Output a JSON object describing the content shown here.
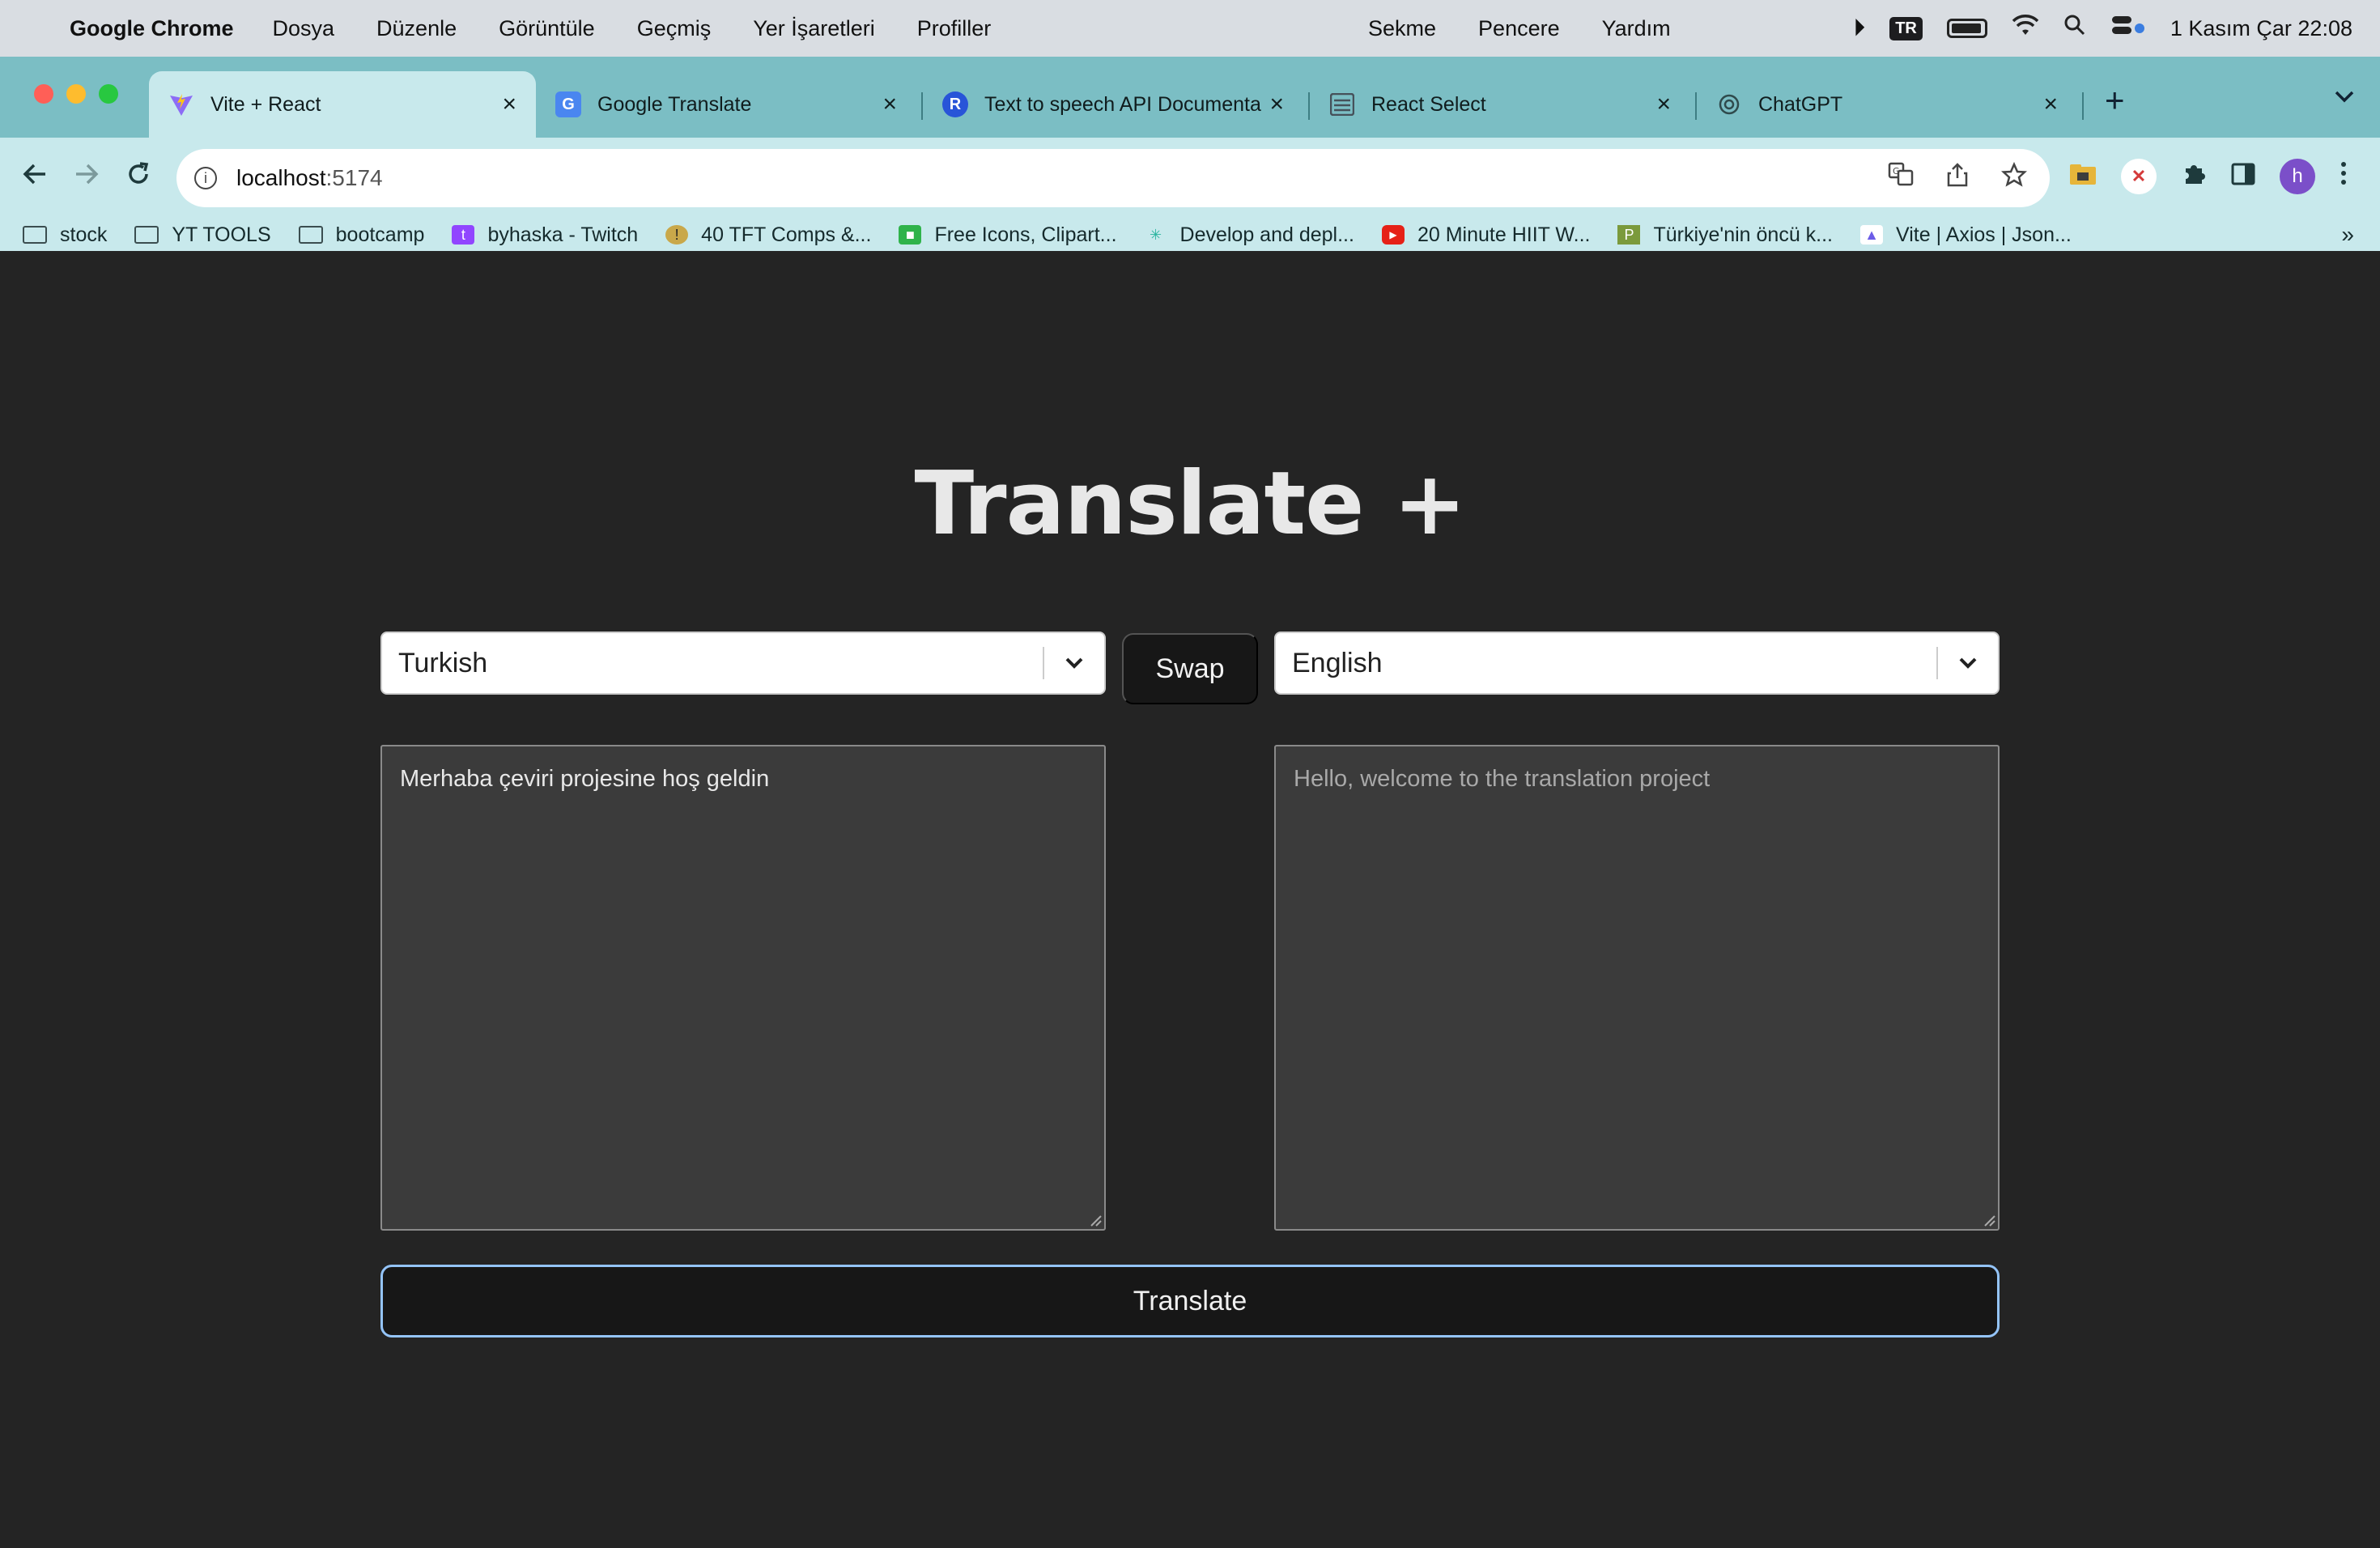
{
  "menubar": {
    "app_name": "Google Chrome",
    "items": [
      "Dosya",
      "Düzenle",
      "Görüntüle",
      "Geçmiş",
      "Yer İşaretleri",
      "Profiller"
    ],
    "right_items": [
      "Sekme",
      "Pencere",
      "Yardım"
    ],
    "input_source": "TR",
    "clock": "1 Kasım Çar  22:08"
  },
  "tabs": [
    {
      "title": "Vite + React",
      "active": true
    },
    {
      "title": "Google Translate",
      "active": false
    },
    {
      "title": "Text to speech API Documentati",
      "active": false
    },
    {
      "title": "React Select",
      "active": false
    },
    {
      "title": "ChatGPT",
      "active": false
    }
  ],
  "omnibox": {
    "host": "localhost",
    "port": ":5174"
  },
  "profile_initial": "h",
  "bookmarks": [
    {
      "label": "stock",
      "icon": "folder-icon"
    },
    {
      "label": "YT TOOLS",
      "icon": "folder-icon"
    },
    {
      "label": "bootcamp",
      "icon": "folder-icon"
    },
    {
      "label": "byhaska - Twitch",
      "icon": "twitch-icon"
    },
    {
      "label": "40 TFT Comps &...",
      "icon": "tft-icon"
    },
    {
      "label": "Free Icons, Clipart...",
      "icon": "icons-site-icon"
    },
    {
      "label": "Develop and depl...",
      "icon": "deploy-icon"
    },
    {
      "label": "20 Minute HIIT W...",
      "icon": "youtube-icon"
    },
    {
      "label": "Türkiye'nin öncü k...",
      "icon": "p-site-icon"
    },
    {
      "label": "Vite | Axios | Json...",
      "icon": "vite-icon"
    }
  ],
  "app": {
    "title": "Translate +",
    "source_language": "Turkish",
    "target_language": "English",
    "swap_label": "Swap",
    "input_text": "Merhaba  çeviri projesine hoş geldin",
    "output_text": "Hello, welcome to the translation project",
    "translate_label": "Translate"
  },
  "colors": {
    "page_background": "#242424",
    "button_background": "#171717",
    "focus_ring": "#94c4f8",
    "tab_strip": "#7bbec4",
    "toolbar": "#c8e9ec"
  }
}
